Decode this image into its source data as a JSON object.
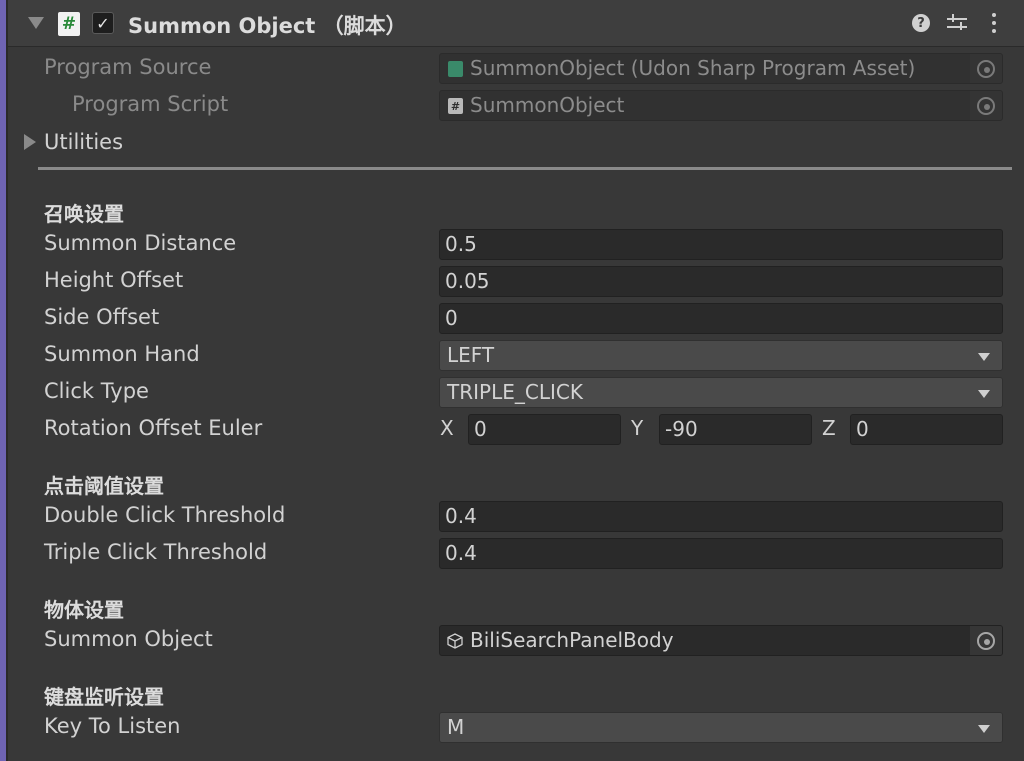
{
  "header": {
    "title": "Summon Object （脚本）",
    "script_glyph": "#",
    "check_glyph": "✓",
    "help_glyph": "?"
  },
  "program": {
    "source_label": "Program Source",
    "source_value": "SummonObject (Udon Sharp Program Asset)",
    "script_label": "Program Script",
    "script_value": "SummonObject",
    "script_glyph": "#"
  },
  "utilities": {
    "label": "Utilities"
  },
  "sections": {
    "summon": "召唤设置",
    "click": "点击阈值设置",
    "object": "物体设置",
    "keyboard": "键盘监听设置"
  },
  "fields": {
    "summon_distance": {
      "label": "Summon Distance",
      "value": "0.5"
    },
    "height_offset": {
      "label": "Height Offset",
      "value": "0.05"
    },
    "side_offset": {
      "label": "Side Offset",
      "value": "0"
    },
    "summon_hand": {
      "label": "Summon Hand",
      "value": "LEFT"
    },
    "click_type": {
      "label": "Click Type",
      "value": "TRIPLE_CLICK"
    },
    "rotation": {
      "label": "Rotation Offset Euler",
      "x_label": "X",
      "x": "0",
      "y_label": "Y",
      "y": "-90",
      "z_label": "Z",
      "z": "0"
    },
    "double_click": {
      "label": "Double Click Threshold",
      "value": "0.4"
    },
    "triple_click": {
      "label": "Triple Click Threshold",
      "value": "0.4"
    },
    "summon_object": {
      "label": "Summon Object",
      "value": "BiliSearchPanelBody"
    },
    "key_to_listen": {
      "label": "Key To Listen",
      "value": "M"
    }
  },
  "icons": {
    "fold": "triangle-down-icon",
    "script": "csharp-script-icon",
    "help": "help-icon",
    "presets": "presets-sliders-icon",
    "menu": "kebab-menu-icon",
    "picker": "object-picker-icon",
    "gameobject": "cube-icon",
    "expand": "triangle-right-icon"
  },
  "colors": {
    "accent": "#6f64b4",
    "panel": "#383838",
    "field": "#2a2a2a",
    "dropdown": "#4a4a4a",
    "text": "#d2d2d2"
  }
}
